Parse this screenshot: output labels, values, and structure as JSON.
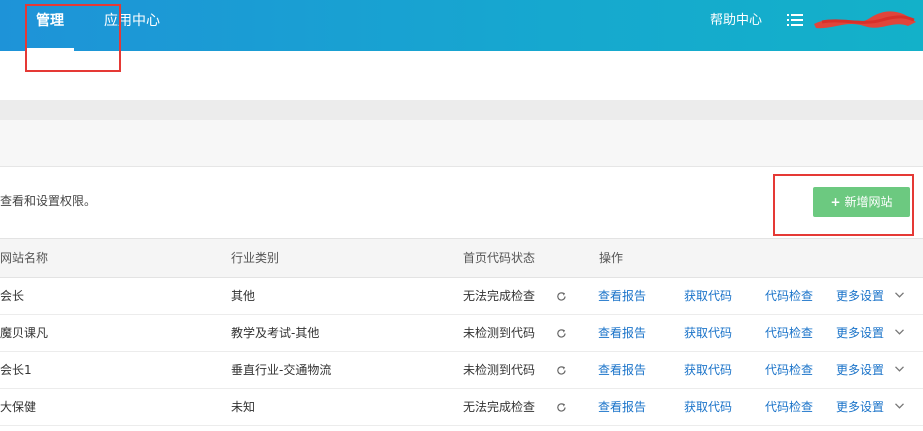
{
  "header": {
    "tabs": [
      {
        "label": "管理",
        "active": true
      },
      {
        "label": "应用中心",
        "active": false
      }
    ],
    "help_label": "帮助中心",
    "menu_icon": "list-menu-icon",
    "user_name_obscured": true
  },
  "page": {
    "description": "查看和设置权限。",
    "add_button_label": "新增网站",
    "add_button_icon": "plus-icon"
  },
  "table": {
    "headers": [
      "网站名称",
      "行业类别",
      "首页代码状态",
      "操作"
    ],
    "rows": [
      {
        "name": "会长",
        "category": "其他",
        "status": "无法完成检查"
      },
      {
        "name": "魔贝课凡",
        "category": "教学及考试-其他",
        "status": "未检测到代码"
      },
      {
        "name": "会长1",
        "category": "垂直行业-交通物流",
        "status": "未检测到代码"
      },
      {
        "name": "大保健",
        "category": "未知",
        "status": "无法完成检查"
      }
    ],
    "actions": {
      "report": "查看报告",
      "get_code": "获取代码",
      "check_code": "代码检查",
      "more": "更多设置"
    }
  },
  "colors": {
    "header_start": "#1e93d8",
    "header_end": "#13b1c9",
    "add_button": "#6cc980",
    "link": "#1a73c9",
    "annotation": "#e53935"
  }
}
